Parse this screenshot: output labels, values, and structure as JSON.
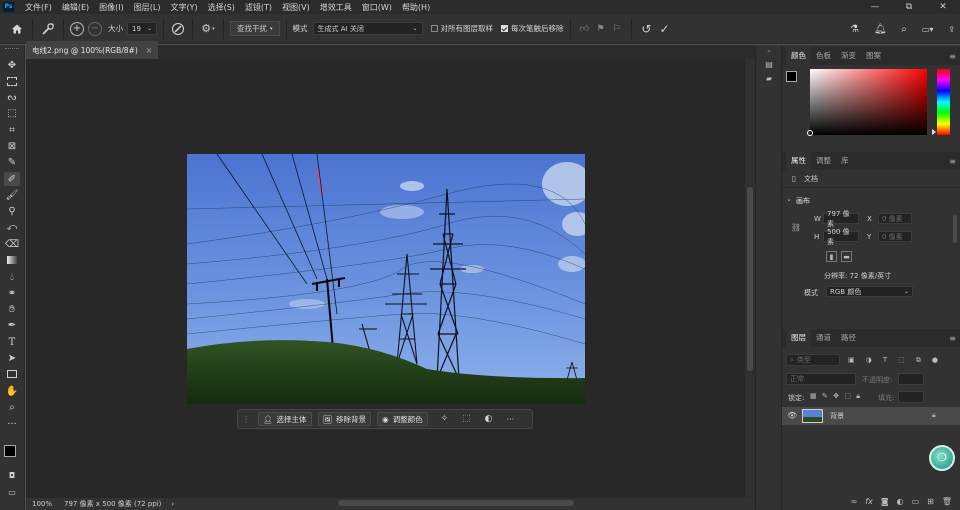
{
  "app": {
    "logo": "Ps"
  },
  "menu": [
    "文件(F)",
    "编辑(E)",
    "图像(I)",
    "图层(L)",
    "文字(Y)",
    "选择(S)",
    "滤镜(T)",
    "视图(V)",
    "增效工具",
    "窗口(W)",
    "帮助(H)"
  ],
  "window_controls": [
    "—",
    "⧉",
    "✕"
  ],
  "options": {
    "size_label": "大小",
    "size_value": "19",
    "find_distractions": "查找干扰",
    "mode_label": "模式",
    "mode_value": "生成式 AI 关闭",
    "sample_all_layers": "对所有图层取样",
    "sample_all_checked": false,
    "remove_after_stroke": "每次笔触后移除",
    "remove_after_checked": true
  },
  "document": {
    "tab_title": "电线2.png @ 100%(RGB/8#)",
    "close": "×"
  },
  "context_bar": {
    "select_subject": "选择主体",
    "remove_background": "移除背景",
    "adjust_color": "调整颜色",
    "more": "···"
  },
  "status": {
    "zoom": "100%",
    "info": "797 像素 x 500 像素 (72 ppi)",
    "arrow": "›"
  },
  "color_panel": {
    "tabs": [
      "颜色",
      "色板",
      "渐变",
      "图案"
    ],
    "hue_color": "#ff0000"
  },
  "properties_panel": {
    "tabs": [
      "属性",
      "调整",
      "库"
    ],
    "doc_label": "文档",
    "section": "画布",
    "w_label": "W",
    "w_value": "797 像素",
    "x_label": "X",
    "x_placeholder": "0 像素",
    "h_label": "H",
    "h_value": "500 像素",
    "y_label": "Y",
    "y_placeholder": "0 像素",
    "resolution": "分辨率: 72 像素/英寸",
    "mode_label": "模式",
    "mode_value": "RGB 颜色"
  },
  "layers_panel": {
    "tabs": [
      "图层",
      "通道",
      "路径"
    ],
    "filter_placeholder": "类型",
    "blend_mode": "正常",
    "opacity_label": "不透明度:",
    "lock_label": "锁定:",
    "fill_label": "填充:",
    "layer_name": "背景"
  }
}
